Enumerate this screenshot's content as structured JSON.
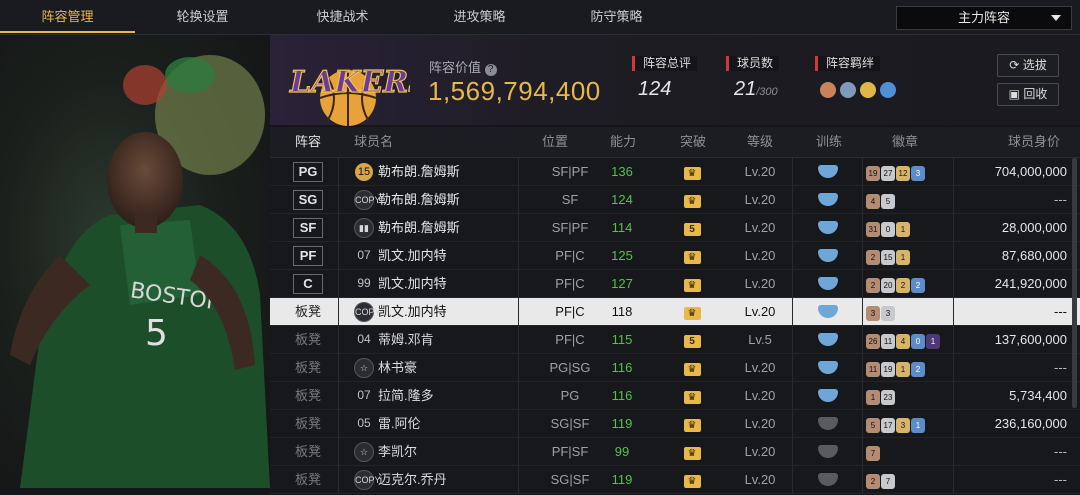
{
  "tabs": [
    "阵容管理",
    "轮换设置",
    "快捷战术",
    "进攻策略",
    "防守策略"
  ],
  "lineup_select": "主力阵容",
  "team": "LAKERS",
  "value_label": "阵容价值",
  "value": "1,569,794,400",
  "stats": [
    {
      "label": "阵容总评",
      "value": "124",
      "sub": ""
    },
    {
      "label": "球员数",
      "value": "21",
      "sub": "/300"
    },
    {
      "label": "阵容羁绊",
      "value": "",
      "sub": ""
    }
  ],
  "buttons": {
    "pick": "选拔",
    "recycle": "回收"
  },
  "columns": [
    "阵容",
    "球员名",
    "位置",
    "能力",
    "突破",
    "等级",
    "训练",
    "徽章",
    "球员身价"
  ],
  "rows": [
    {
      "slot": "PG",
      "num": "15",
      "name": "勒布朗.詹姆斯",
      "pos": "SF|PF",
      "ability": "136",
      "breakthrough": "",
      "level": "Lv.20",
      "badges": [
        "19",
        "27",
        "12",
        "3"
      ],
      "price": "704,000,000"
    },
    {
      "slot": "SG",
      "num": "COPY",
      "name": "勒布朗.詹姆斯",
      "pos": "SF",
      "ability": "124",
      "breakthrough": "",
      "level": "Lv.20",
      "badges": [
        "4",
        "5"
      ],
      "price": "---"
    },
    {
      "slot": "SF",
      "num": "",
      "name": "勒布朗.詹姆斯",
      "pos": "SF|PF",
      "ability": "114",
      "breakthrough": "5",
      "level": "Lv.20",
      "badges": [
        "31",
        "0",
        "1"
      ],
      "price": "28,000,000"
    },
    {
      "slot": "PF",
      "num": "07",
      "name": "凯文.加内特",
      "pos": "PF|C",
      "ability": "125",
      "breakthrough": "",
      "level": "Lv.20",
      "badges": [
        "2",
        "15",
        "1"
      ],
      "price": "87,680,000"
    },
    {
      "slot": "C",
      "num": "99",
      "name": "凯文.加内特",
      "pos": "PF|C",
      "ability": "127",
      "breakthrough": "",
      "level": "Lv.20",
      "badges": [
        "2",
        "20",
        "2",
        "2"
      ],
      "price": "241,920,000"
    },
    {
      "slot": "板凳",
      "num": "COPY",
      "name": "凯文.加内特",
      "pos": "PF|C",
      "ability": "118",
      "breakthrough": "",
      "level": "Lv.20",
      "badges": [
        "3",
        "3"
      ],
      "price": "---"
    },
    {
      "slot": "板凳",
      "num": "04",
      "name": "蒂姆.邓肯",
      "pos": "PF|C",
      "ability": "115",
      "breakthrough": "5",
      "level": "Lv.5",
      "badges": [
        "26",
        "11",
        "4",
        "0",
        "1"
      ],
      "price": "137,600,000"
    },
    {
      "slot": "板凳",
      "num": "☆",
      "name": "林书豪",
      "pos": "PG|SG",
      "ability": "116",
      "breakthrough": "",
      "level": "Lv.20",
      "badges": [
        "11",
        "19",
        "1",
        "2"
      ],
      "price": "---"
    },
    {
      "slot": "板凳",
      "num": "07",
      "name": "拉简.隆多",
      "pos": "PG",
      "ability": "116",
      "breakthrough": "",
      "level": "Lv.20",
      "badges": [
        "1",
        "23"
      ],
      "price": "5,734,400"
    },
    {
      "slot": "板凳",
      "num": "05",
      "name": "雷.阿伦",
      "pos": "SG|SF",
      "ability": "119",
      "breakthrough": "",
      "level": "Lv.20",
      "badges": [
        "5",
        "17",
        "3",
        "1"
      ],
      "price": "236,160,000"
    },
    {
      "slot": "板凳",
      "num": "☆",
      "name": "李凯尔",
      "pos": "PF|SF",
      "ability": "99",
      "breakthrough": "",
      "level": "Lv.20",
      "badges": [
        "7"
      ],
      "price": "---"
    },
    {
      "slot": "板凳",
      "num": "COPY",
      "name": "迈克尔.乔丹",
      "pos": "SG|SF",
      "ability": "119",
      "breakthrough": "",
      "level": "Lv.20",
      "badges": [
        "2",
        "7"
      ],
      "price": "---"
    }
  ],
  "colors": {
    "accent": "#e8b84a",
    "ability": "#52c24a",
    "stat_marker": "#d0393a"
  }
}
